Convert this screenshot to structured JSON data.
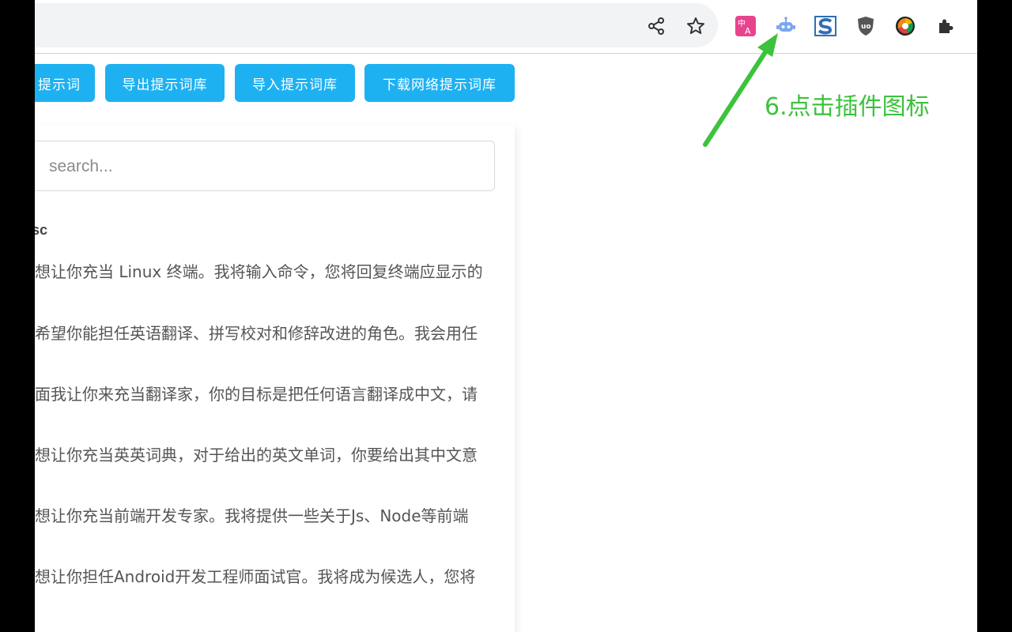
{
  "toolbar": {
    "icons": [
      "share-icon",
      "bookmark-star-icon",
      "translate-extension-icon",
      "prompt-extension-icon",
      "s-extension-icon",
      "ublock-origin-icon",
      "chrome-color-extension-icon",
      "puzzle-extensions-icon"
    ]
  },
  "buttons": {
    "partial_label": "提示词",
    "export_label": "导出提示词库",
    "import_label": "导入提示词库",
    "download_label": "下载网络提示词库"
  },
  "search": {
    "placeholder": "search..."
  },
  "list": {
    "header": "sc",
    "items": [
      "想让你充当 Linux 终端。我将输入命令，您将回复终端应显示的",
      "希望你能担任英语翻译、拼写校对和修辞改进的角色。我会用任",
      "面我让你来充当翻译家，你的目标是把任何语言翻译成中文，请",
      "想让你充当英英词典，对于给出的英文单词，你要给出其中文意",
      "想让你充当前端开发专家。我将提供一些关于Js、Node等前端",
      "想让你担任Android开发工程师面试官。我将成为候选人，您将"
    ]
  },
  "annotation": {
    "text": "6.点击插件图标",
    "color": "#3cc23c"
  },
  "colors": {
    "accent": "#1eb1f2",
    "annotation": "#3cc23c"
  }
}
